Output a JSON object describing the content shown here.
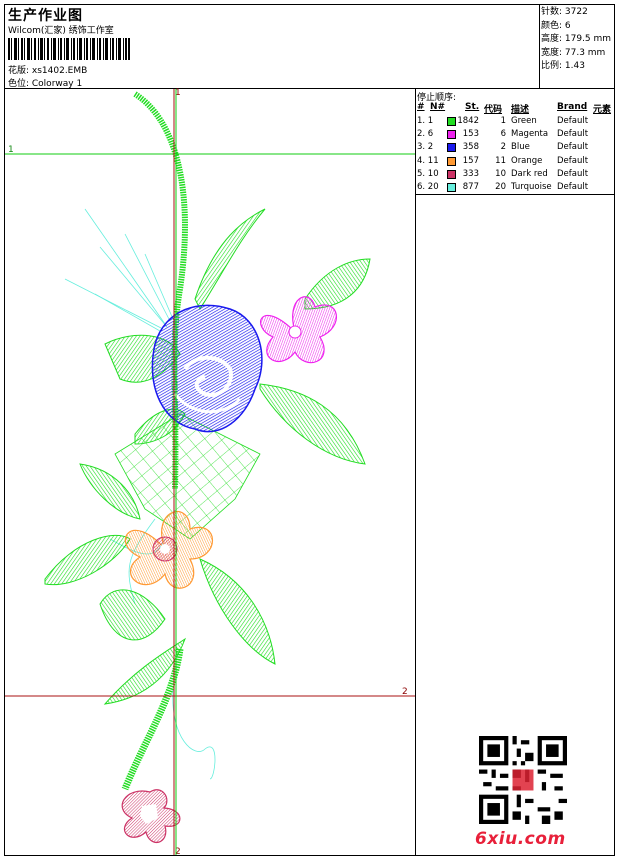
{
  "header": {
    "title": "生产作业图",
    "subtitle": "Wilcom(汇家) 绣饰工作室",
    "design_label": "花版: xs1402.EMB",
    "colorway_label": "色位: Colorway 1"
  },
  "stats": {
    "stitches": "针数: 3722",
    "colors": "颜色: 6",
    "height": "高度: 179.5 mm",
    "width": "宽度: 77.3 mm",
    "scale": "比例: 1.43"
  },
  "stop_sequence": {
    "title": "停止顺序:",
    "headers": [
      "#",
      "N#",
      "St.",
      "代码",
      "描述",
      "Brand",
      "元素"
    ],
    "rows": [
      {
        "idx": "1. 1",
        "stitches": "1842",
        "code": "1",
        "desc": "Green",
        "brand": "Default",
        "color": "#22dd22"
      },
      {
        "idx": "2. 6",
        "stitches": "153",
        "code": "6",
        "desc": "Magenta",
        "brand": "Default",
        "color": "#ee22ee"
      },
      {
        "idx": "3. 2",
        "stitches": "358",
        "code": "2",
        "desc": "Blue",
        "brand": "Default",
        "color": "#1a1aee"
      },
      {
        "idx": "4. 11",
        "stitches": "157",
        "code": "11",
        "desc": "Orange",
        "brand": "Default",
        "color": "#ff9933"
      },
      {
        "idx": "5. 10",
        "stitches": "333",
        "code": "10",
        "desc": "Dark red",
        "brand": "Default",
        "color": "#cc3366"
      },
      {
        "idx": "6. 20",
        "stitches": "877",
        "code": "20",
        "desc": "Turquoise",
        "brand": "Default",
        "color": "#66eedd"
      }
    ]
  },
  "guides": {
    "label_1": "1",
    "label_2": "2"
  },
  "watermark": "6xiu.com",
  "colors": {
    "green": "#22dd22",
    "magenta": "#ee22ee",
    "blue": "#1a1aee",
    "orange": "#ff9933",
    "dark_red": "#cc3366",
    "turquoise": "#66eedd",
    "guide_green": "#11cc11",
    "guide_red": "#aa1111"
  }
}
